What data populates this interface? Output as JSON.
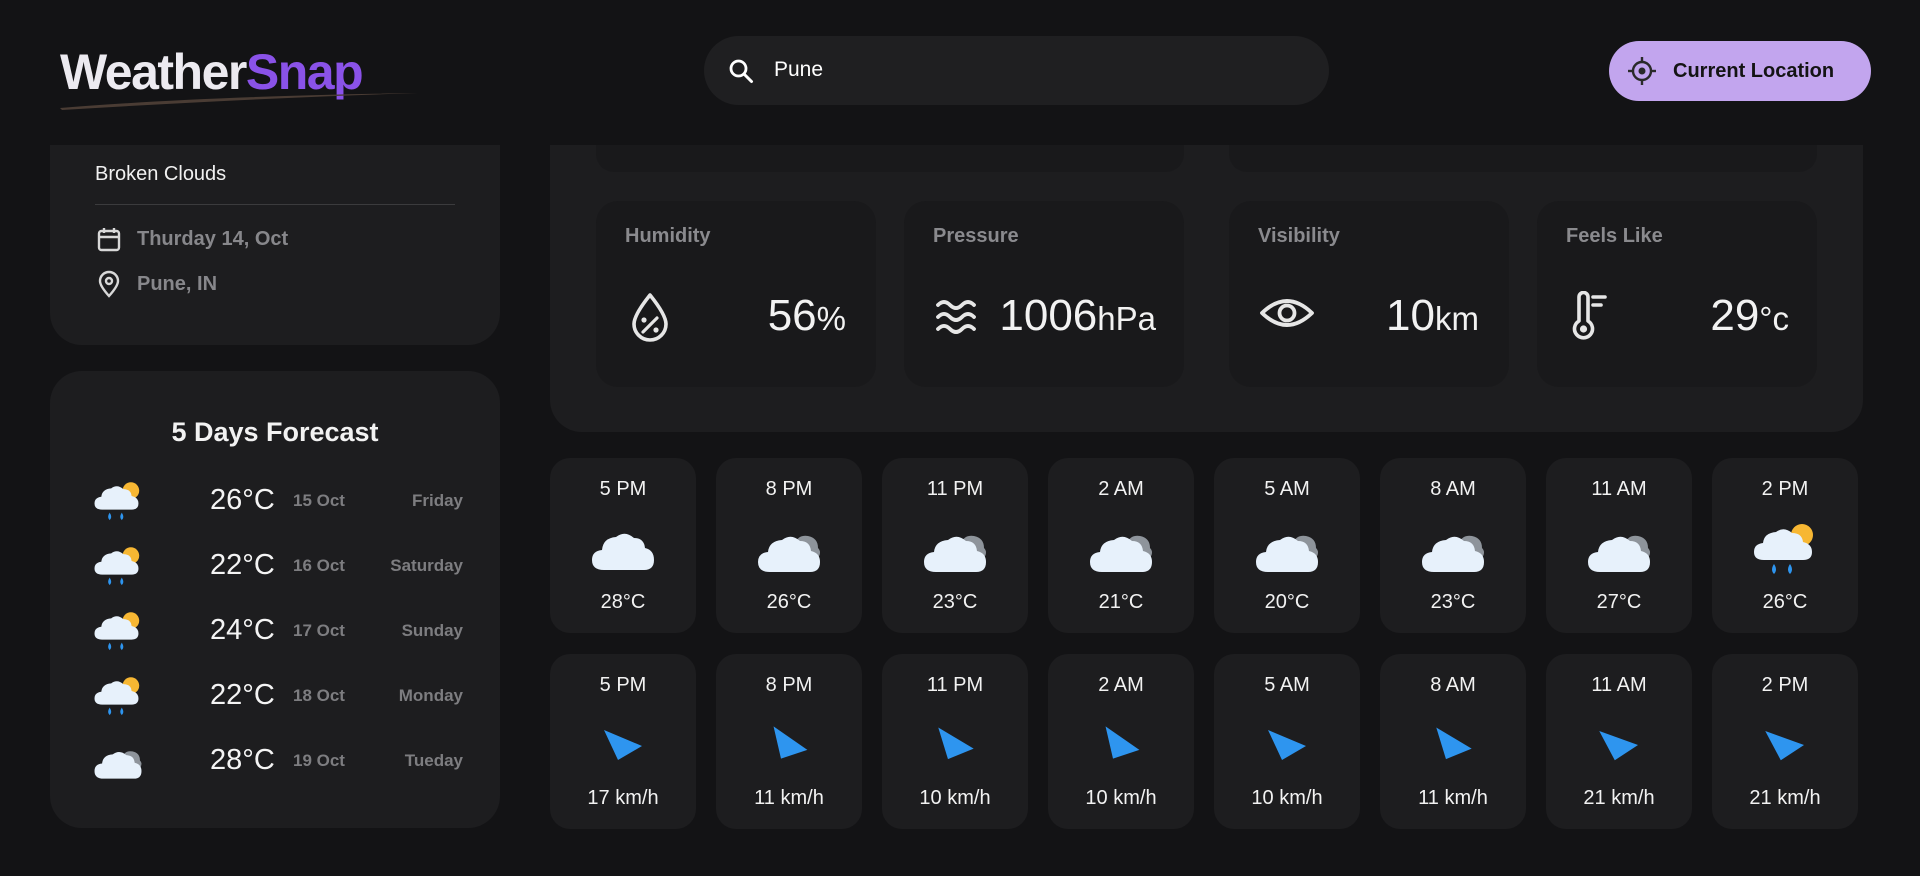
{
  "header": {
    "logo_part1": "Weather",
    "logo_part2": "Snap",
    "search_value": "Pune",
    "location_button_label": "Current Location"
  },
  "current": {
    "condition": "Broken Clouds",
    "date": "Thurday 14, Oct",
    "location": "Pune, IN"
  },
  "forecast": {
    "title": "5 Days Forecast",
    "days": [
      {
        "icon": "sun-cloud-rain-icon",
        "temp": "26°C",
        "date": "15 Oct",
        "day": "Friday"
      },
      {
        "icon": "sun-cloud-rain-icon",
        "temp": "22°C",
        "date": "16 Oct",
        "day": "Saturday"
      },
      {
        "icon": "sun-cloud-rain-icon",
        "temp": "24°C",
        "date": "17 Oct",
        "day": "Sunday"
      },
      {
        "icon": "sun-cloud-rain-icon",
        "temp": "22°C",
        "date": "18 Oct",
        "day": "Monday"
      },
      {
        "icon": "broken-clouds-icon",
        "temp": "28°C",
        "date": "19 Oct",
        "day": "Tueday"
      }
    ]
  },
  "highlights": {
    "humidity": {
      "label": "Humidity",
      "value": "56",
      "unit": "%"
    },
    "pressure": {
      "label": "Pressure",
      "value": "1006",
      "unit": "hPa"
    },
    "visibility": {
      "label": "Visibility",
      "value": "10",
      "unit": "km"
    },
    "feels_like": {
      "label": "Feels Like",
      "value": "29",
      "unit": "°c"
    }
  },
  "hourly": {
    "temps": [
      {
        "time": "5 PM",
        "icon": "cloud-icon",
        "value": "28°C"
      },
      {
        "time": "8 PM",
        "icon": "broken-clouds-icon",
        "value": "26°C"
      },
      {
        "time": "11 PM",
        "icon": "broken-clouds-icon",
        "value": "23°C"
      },
      {
        "time": "2 AM",
        "icon": "broken-clouds-icon",
        "value": "21°C"
      },
      {
        "time": "5 AM",
        "icon": "broken-clouds-icon",
        "value": "20°C"
      },
      {
        "time": "8 AM",
        "icon": "broken-clouds-icon",
        "value": "23°C"
      },
      {
        "time": "11 AM",
        "icon": "broken-clouds-icon",
        "value": "27°C"
      },
      {
        "time": "2 PM",
        "icon": "sun-cloud-rain-icon",
        "value": "26°C"
      }
    ],
    "wind": [
      {
        "time": "5 PM",
        "icon": "wind-direction-icon",
        "value": "17 km/h"
      },
      {
        "time": "8 PM",
        "icon": "wind-direction-icon",
        "value": "11 km/h"
      },
      {
        "time": "11 PM",
        "icon": "wind-direction-icon",
        "value": "10 km/h"
      },
      {
        "time": "2 AM",
        "icon": "wind-direction-icon",
        "value": "10 km/h"
      },
      {
        "time": "5 AM",
        "icon": "wind-direction-icon",
        "value": "10 km/h"
      },
      {
        "time": "8 AM",
        "icon": "wind-direction-icon",
        "value": "11 km/h"
      },
      {
        "time": "11 AM",
        "icon": "wind-direction-icon",
        "value": "21 km/h"
      },
      {
        "time": "2 PM",
        "icon": "wind-direction-icon",
        "value": "21 km/h"
      }
    ]
  },
  "colors": {
    "background": "#131315",
    "card": "#1d1d1f",
    "accent_purple": "#8a52e8",
    "button": "#c2a5ee",
    "wind_arrow": "#2e95ef",
    "sun": "#f7b733"
  }
}
